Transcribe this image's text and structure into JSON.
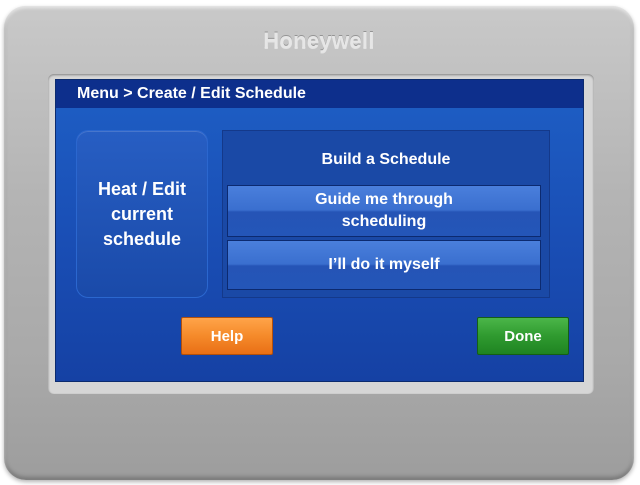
{
  "device": {
    "brand": "Honeywell"
  },
  "header": {
    "breadcrumb": "Menu > Create / Edit Schedule"
  },
  "left_tile": {
    "line1": "Heat / Edit",
    "line2": "current",
    "line3": "schedule"
  },
  "build_panel": {
    "title": "Build a Schedule",
    "option1_line1": "Guide me through",
    "option1_line2": "scheduling",
    "option2": "I’ll do it myself"
  },
  "footer": {
    "help_label": "Help",
    "done_label": "Done"
  },
  "colors": {
    "screen_blue": "#1a4fb6",
    "header_blue": "#0d2f8c",
    "help_orange": "#f58a2a",
    "done_green": "#2f9a2f"
  }
}
